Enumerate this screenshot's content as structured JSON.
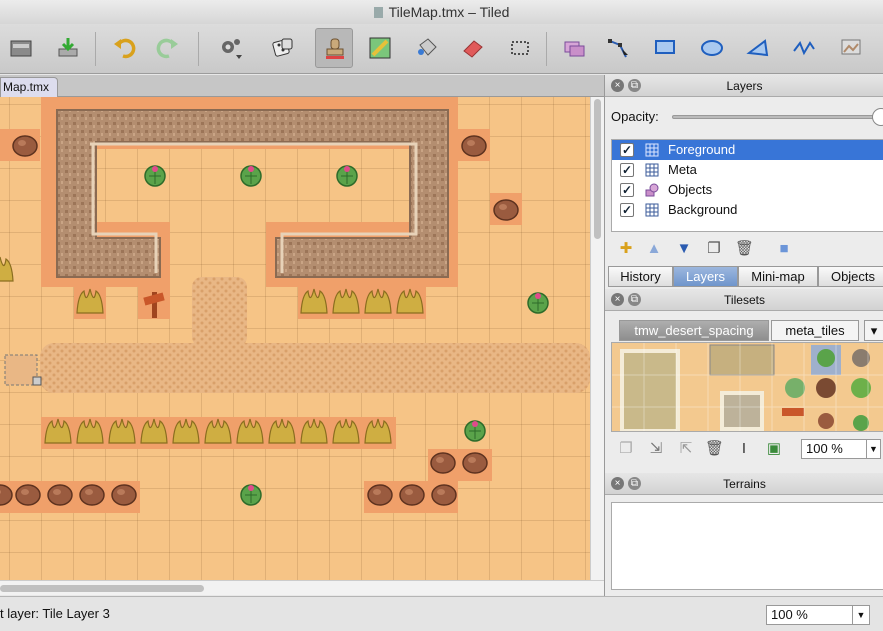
{
  "window": {
    "title": "TileMap.tmx – Tiled"
  },
  "toolbar": {
    "buttons": [
      "open-icon",
      "save-icon",
      "undo-icon",
      "redo-icon",
      "random-mode-icon",
      "dice-icon",
      "stamp-brush-icon",
      "terrain-brush-icon",
      "bucket-fill-icon",
      "eraser-icon",
      "rect-select-icon",
      "select-objects-icon",
      "edit-polygons-icon",
      "insert-rectangle-icon",
      "insert-ellipse-icon",
      "insert-polygon-icon",
      "insert-polyline-icon",
      "insert-tile-icon"
    ]
  },
  "editor": {
    "tab_label": "Map.tmx",
    "status": "t layer: Tile Layer 3",
    "zoom": "100 %"
  },
  "layers_panel": {
    "title": "Layers",
    "opacity_label": "Opacity:",
    "opacity": 1.0,
    "items": [
      {
        "name": "Foreground",
        "visible": true,
        "selected": true,
        "icon": "tile-layer-icon"
      },
      {
        "name": "Meta",
        "visible": true,
        "selected": false,
        "icon": "tile-layer-icon"
      },
      {
        "name": "Objects",
        "visible": true,
        "selected": false,
        "icon": "object-layer-icon"
      },
      {
        "name": "Background",
        "visible": true,
        "selected": false,
        "icon": "tile-layer-icon"
      }
    ]
  },
  "dock_tabs": [
    "History",
    "Layers",
    "Mini-map",
    "Objects"
  ],
  "dock_active_tab": "Layers",
  "tilesets_panel": {
    "title": "Tilesets",
    "tabs": [
      "tmw_desert_spacing",
      "meta_tiles"
    ],
    "active_tab": "tmw_desert_spacing",
    "zoom": "100 %"
  },
  "terrains_panel": {
    "title": "Terrains"
  },
  "colors": {
    "accent": "#3875d7",
    "sand": "#f6c486",
    "wall_border": "#f0a06a",
    "wall_stone": "#b08a6a"
  }
}
